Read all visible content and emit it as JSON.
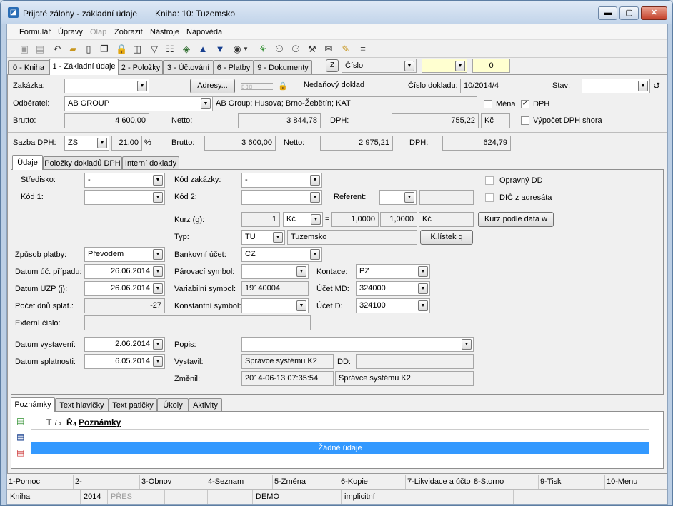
{
  "window": {
    "title": "Přijaté zálohy - základní údaje",
    "book": "Kniha: 10: Tuzemsko",
    "min": "▬",
    "max": "▢",
    "close": "✕"
  },
  "menu": [
    "Formulář",
    "Úpravy",
    "Olap",
    "Zobrazit",
    "Nástroje",
    "Nápověda"
  ],
  "tabs": [
    "0 - Kniha",
    "1 - Základní údaje",
    "2 - Položky",
    "3 - Účtování",
    "6 - Platby",
    "9 - Dokumenty"
  ],
  "toolbar_right": {
    "sort_key": "Z",
    "sort_field": "Číslo",
    "count": "0"
  },
  "header": {
    "zakazka_label": "Zakázka:",
    "adresy_button": "Adresy...",
    "nedanovy": "Nedaňový doklad",
    "cislo_label": "Číslo dokladu:",
    "cislo_value": "10/2014/4",
    "stav_label": "Stav:",
    "odberatel_label": "Odběratel:",
    "odberatel_value": "AB GROUP",
    "odberatel_addr": "AB Group; Husova; Brno-Žebětín; KAT",
    "mena_label": "Měna",
    "dph_label": "DPH",
    "dph_checked": "✓",
    "brutto_label": "Brutto:",
    "brutto_value": "4 600,00",
    "netto_label": "Netto:",
    "netto_value": "3 844,78",
    "dph_amount_label": "DPH:",
    "dph_amount_value": "755,22",
    "currency": "Kč",
    "vypocet_label": "Výpočet DPH shora",
    "sazba_label": "Sazba DPH:",
    "sazba_code": "ZS",
    "sazba_pct": "21,00",
    "pct_sign": "%",
    "brutto2_value": "3 600,00",
    "netto2_value": "2 975,21",
    "dph2_value": "624,79"
  },
  "subtabs": [
    "Údaje",
    "Položky dokladů DPH",
    "Interní doklady"
  ],
  "form": {
    "stredisko_label": "Středisko:",
    "stredisko_value": "-",
    "kod_zakazky_label": "Kód zakázky:",
    "kod_zakazky_value": "-",
    "opravny_label": "Opravný DD",
    "kod1_label": "Kód 1:",
    "kod2_label": "Kód 2:",
    "referent_label": "Referent:",
    "dic_label": "DIČ z adresáta",
    "kurz_label": "Kurz (g):",
    "kurz_value": "1",
    "kurz_currency": "Kč",
    "eq": "=",
    "kurz_rate": "1,0000",
    "kurz_rate2": "1,0000",
    "kurz_currency2": "Kč",
    "kurz_button": "Kurz podle data w",
    "typ_label": "Typ:",
    "typ_code": "TU",
    "typ_name": "Tuzemsko",
    "listek_button": "K.lístek q",
    "zpusob_label": "Způsob platby:",
    "zpusob_value": "Převodem",
    "bank_label": "Bankovní účet:",
    "bank_value": "CZ",
    "datum_uc_label": "Datum úč. případu:",
    "datum_uc_value": "26.06.2014",
    "parovaci_label": "Párovací symbol:",
    "kontace_label": "Kontace:",
    "kontace_value": "PZ",
    "datum_uzp_label": "Datum UZP (j):",
    "datum_uzp_value": "26.06.2014",
    "vs_label": "Variabilní symbol:",
    "vs_value": "19140004",
    "ucet_md_label": "Účet MD:",
    "ucet_md_value": "324000",
    "pocet_label": "Počet dnů splat.:",
    "pocet_value": "-27",
    "ks_label": "Konstantní symbol:",
    "ucet_d_label": "Účet D:",
    "ucet_d_value": "324100",
    "externi_label": "Externí číslo:",
    "vystaveni_label": "Datum vystavení:",
    "vystaveni_value": "2.06.2014",
    "popis_label": "Popis:",
    "splatnost_label": "Datum splatnosti:",
    "splatnost_value": "6.05.2014",
    "vystavil_label": "Vystavil:",
    "vystavil_value": "Správce systému K2",
    "dd_label": "DD:",
    "zmenil_label": "Změnil:",
    "zmenil_date": "2014-06-13 07:35:54",
    "zmenil_user": "Správce systému K2"
  },
  "bottom_tabs": [
    "Poznámky",
    "Text hlavičky",
    "Text patičky",
    "Úkoly",
    "Aktivity"
  ],
  "notes": {
    "col_t": "T",
    "col_sort": "/ ₃",
    "col_r": "Ř̃₄",
    "col_title": "Poznámky",
    "empty": "Žádné údaje"
  },
  "fkeys": [
    "1-Pomoc",
    "2-",
    "3-Obnov",
    "4-Seznam",
    "5-Změna",
    "6-Kopie",
    "7-Likvidace a účto",
    "8-Storno",
    "9-Tisk",
    "10-Menu"
  ],
  "status": [
    "Kniha",
    "2014",
    "PŘES",
    "",
    "",
    "DEMO",
    "",
    "implicitní",
    "",
    ""
  ],
  "colors": {
    "accent": "#3399ff",
    "title_bg": "#c2d4ea"
  }
}
